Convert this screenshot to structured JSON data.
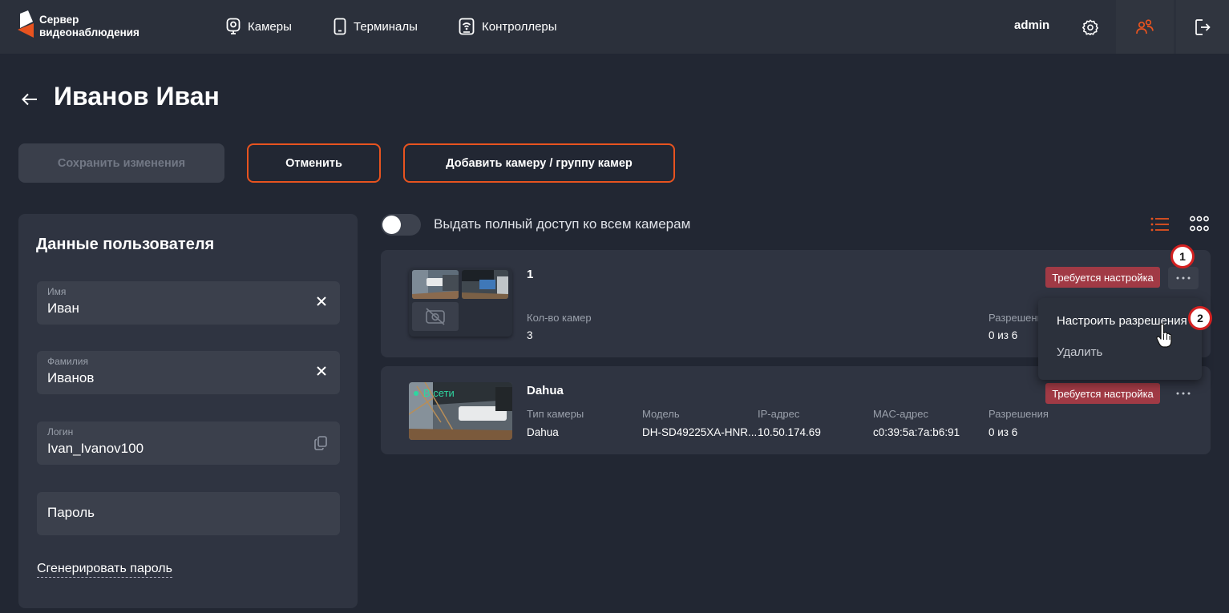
{
  "header": {
    "logo_line1": "Сервер",
    "logo_line2": "видеонаблюдения",
    "nav": [
      {
        "label": "Камеры",
        "icon": "camera-icon"
      },
      {
        "label": "Терминалы",
        "icon": "terminal-icon"
      },
      {
        "label": "Контроллеры",
        "icon": "controller-icon"
      }
    ],
    "username": "admin",
    "accent_color": "#e8531f"
  },
  "page": {
    "title": "Иванов Иван"
  },
  "actions": {
    "save": "Сохранить изменения",
    "cancel": "Отменить",
    "add_camera": "Добавить камеру / группу камер"
  },
  "user_panel": {
    "title": "Данные пользователя",
    "first_name": {
      "label": "Имя",
      "value": "Иван"
    },
    "last_name": {
      "label": "Фамилия",
      "value": "Иванов"
    },
    "login": {
      "label": "Логин",
      "value": "Ivan_Ivanov100"
    },
    "password": {
      "placeholder": "Пароль"
    },
    "generate_password": "Сгенерировать пароль"
  },
  "access": {
    "full_access_label": "Выдать полный доступ ко всем камерам",
    "full_access_enabled": false
  },
  "cameras": [
    {
      "name": "1",
      "type": "group",
      "count_label": "Кол-во камер",
      "count_value": "3",
      "perm_label": "Разрешения",
      "perm_value": "0 из 6",
      "badge": "Требуется настройка"
    },
    {
      "name": "Dahua",
      "type": "camera",
      "status": "В сети",
      "type_label": "Тип камеры",
      "type_value": "Dahua",
      "model_label": "Модель",
      "model_value": "DH-SD49225XA-HNR...",
      "ip_label": "IP-адрес",
      "ip_value": "10.50.174.69",
      "mac_label": "MAC-адрес",
      "mac_value": "c0:39:5a:7a:b6:91",
      "perm_label": "Разрешения",
      "perm_value": "0 из 6",
      "badge": "Требуется настройка"
    }
  ],
  "dropdown": {
    "configure": "Настроить разрешения",
    "delete": "Удалить"
  },
  "markers": [
    "1",
    "2"
  ]
}
